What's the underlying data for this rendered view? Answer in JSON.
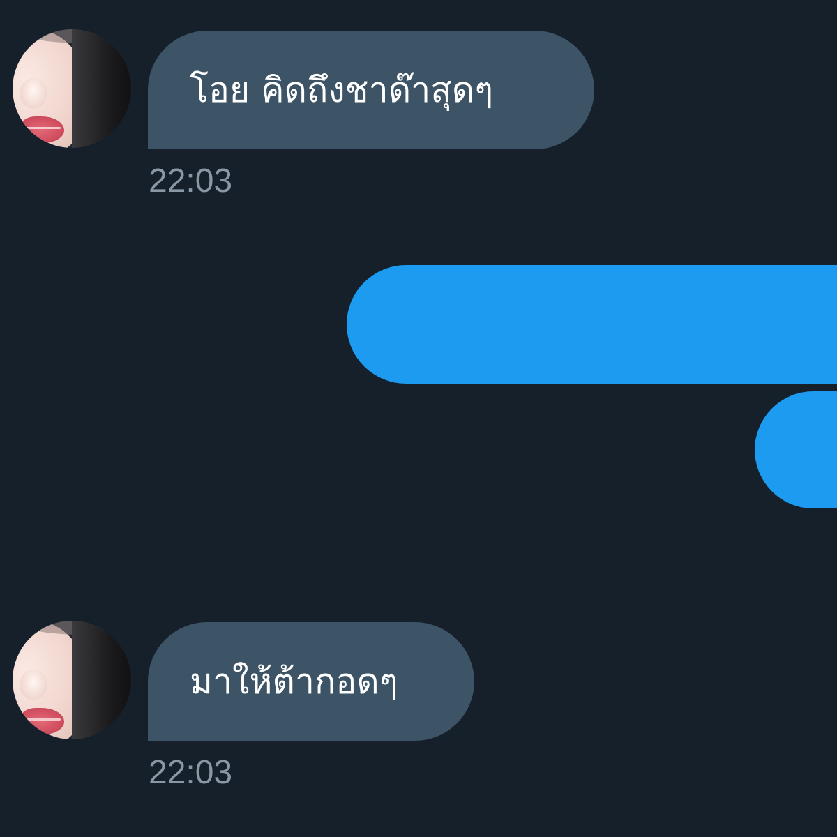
{
  "messages": [
    {
      "sender": "other",
      "text": "โอย คิดถึงชาด๊าสุดๆ",
      "time": "22:03"
    },
    {
      "sender": "self",
      "text": ""
    },
    {
      "sender": "self",
      "text": ""
    },
    {
      "sender": "other",
      "text": "มาให้ต้ากอดๆ",
      "time": "22:03"
    }
  ],
  "colors": {
    "background": "#15202b",
    "incoming_bubble": "#3d5466",
    "outgoing_bubble": "#1d9bf0",
    "timestamp": "#8a98a6"
  }
}
